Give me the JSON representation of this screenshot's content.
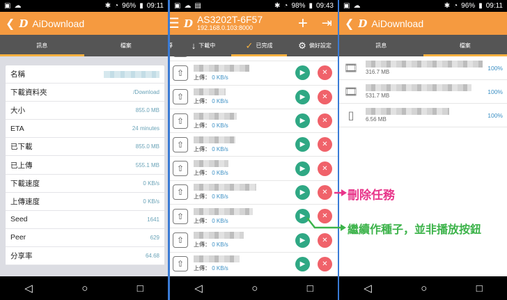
{
  "panel1": {
    "status": {
      "battery": "96%",
      "time": "09:11"
    },
    "title": "AiDownload",
    "logo": "D",
    "tabs": [
      "訊息",
      "檔案"
    ],
    "rows": [
      {
        "k": "名稱",
        "v": ""
      },
      {
        "k": "下載資料夾",
        "v": "/Download"
      },
      {
        "k": "大小",
        "v": "855.0 MB"
      },
      {
        "k": "ETA",
        "v": "24 minutes"
      },
      {
        "k": "已下載",
        "v": "855.0 MB"
      },
      {
        "k": "已上傳",
        "v": "555.1 MB"
      },
      {
        "k": "下載速度",
        "v": "0 KB/s"
      },
      {
        "k": "上傳速度",
        "v": "0 KB/s"
      },
      {
        "k": "Seed",
        "v": "1641"
      },
      {
        "k": "Peer",
        "v": "629"
      },
      {
        "k": "分享率",
        "v": "64.68"
      }
    ]
  },
  "panel2": {
    "status": {
      "battery": "98%",
      "time": "09:43"
    },
    "title": "AS3202T-6F57",
    "subtitle": "192.168.0.103:8000",
    "tabs": [
      "導",
      "下載中",
      "已完成",
      "偏好設定"
    ],
    "upload_label": "上傳：",
    "speed": "0 KB/s",
    "rows": 10
  },
  "panel3": {
    "status": {
      "battery": "96%",
      "time": "09:11"
    },
    "title": "AiDownload",
    "tabs": [
      "訊息",
      "檔案"
    ],
    "files": [
      {
        "type": "video",
        "size": "316.7 MB",
        "pct": "100%"
      },
      {
        "type": "video",
        "size": "531.7 MB",
        "pct": "100%"
      },
      {
        "type": "file",
        "size": "6.56 MB",
        "pct": "100%"
      }
    ]
  },
  "annotations": {
    "delete": "刪除任務",
    "seed": "繼續作種子，並非播放按鈕",
    "delete_color": "#e8358a",
    "seed_color": "#3cb34a"
  }
}
